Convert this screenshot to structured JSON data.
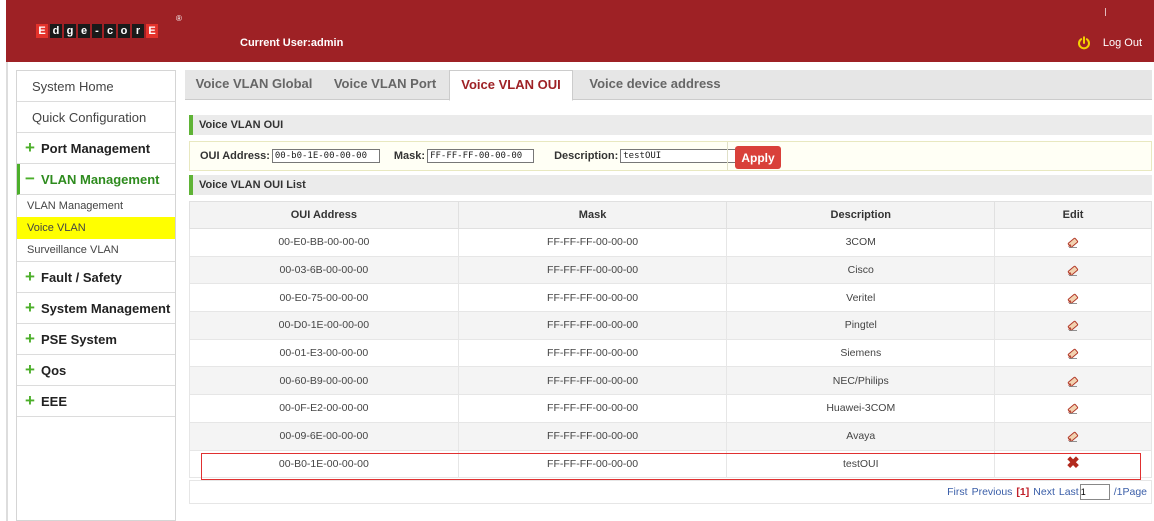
{
  "header": {
    "logo_letters": [
      "E",
      "d",
      "g",
      "e",
      "-",
      "c",
      "o",
      "r",
      "E"
    ],
    "registered_mark": "®",
    "current_user": "Current User:admin",
    "logout_label": "Log Out",
    "colors": {
      "header_bg": "#9e2125",
      "accent_green": "#4caf2a",
      "apply_red": "#d9403a"
    }
  },
  "sidebar": {
    "system_home": "System Home",
    "quick_config": "Quick Configuration",
    "port_management": "Port Management",
    "vlan_management": "VLAN Management",
    "vlan_sub": [
      "VLAN Management",
      "Voice VLAN",
      "Surveillance VLAN"
    ],
    "fault_safety": "Fault / Safety",
    "system_management": "System Management",
    "pse_system": "PSE System",
    "qos": "Qos",
    "eee": "EEE"
  },
  "tabs": [
    "Voice VLAN Global",
    "Voice VLAN Port",
    "Voice VLAN OUI",
    "Voice device address"
  ],
  "form": {
    "section_title": "Voice VLAN OUI",
    "oui_label": "OUI Address:",
    "oui_value": "00-b0-1E-00-00-00",
    "mask_label": "Mask:",
    "mask_value": "FF-FF-FF-00-00-00",
    "desc_label": "Description:",
    "desc_value": "testOUI",
    "apply_label": "Apply"
  },
  "list": {
    "section_title": "Voice VLAN OUI List",
    "columns": [
      "OUI Address",
      "Mask",
      "Description",
      "Edit"
    ],
    "rows": [
      [
        "00-E0-BB-00-00-00",
        "FF-FF-FF-00-00-00",
        "3COM"
      ],
      [
        "00-03-6B-00-00-00",
        "FF-FF-FF-00-00-00",
        "Cisco"
      ],
      [
        "00-E0-75-00-00-00",
        "FF-FF-FF-00-00-00",
        "Veritel"
      ],
      [
        "00-D0-1E-00-00-00",
        "FF-FF-FF-00-00-00",
        "Pingtel"
      ],
      [
        "00-01-E3-00-00-00",
        "FF-FF-FF-00-00-00",
        "Siemens"
      ],
      [
        "00-60-B9-00-00-00",
        "FF-FF-FF-00-00-00",
        "NEC/Philips"
      ],
      [
        "00-0F-E2-00-00-00",
        "FF-FF-FF-00-00-00",
        "Huawei-3COM"
      ],
      [
        "00-09-6E-00-00-00",
        "FF-FF-FF-00-00-00",
        "Avaya"
      ],
      [
        "00-B0-1E-00-00-00",
        "FF-FF-FF-00-00-00",
        "testOUI"
      ]
    ]
  },
  "pager": {
    "first": "First",
    "previous": "Previous",
    "current": "[1]",
    "next": "Next",
    "last": "Last",
    "page_input": "1",
    "total": "/1Page"
  }
}
